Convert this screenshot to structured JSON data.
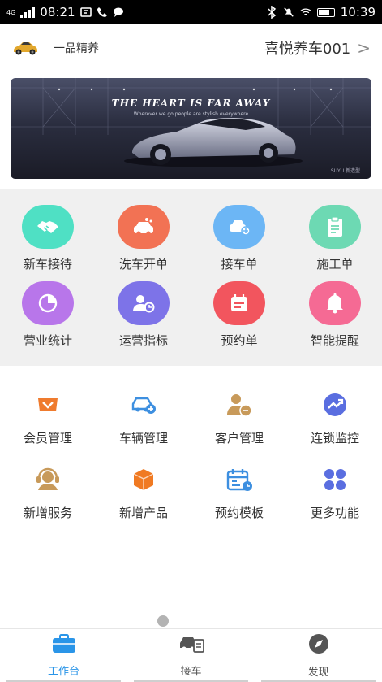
{
  "status_bar": {
    "network": "4G",
    "time_left": "08:21",
    "time_right": "10:39"
  },
  "header": {
    "shop_name": "一品精养",
    "store_name": "喜悦养车001",
    "chevron": ">"
  },
  "banner": {
    "title": "THE HEART IS FAR AWAY",
    "subtitle": "Wherever we go people are stylish everywhere",
    "brand": "SUYU 新造型"
  },
  "quick_actions": [
    {
      "label": "新车接待",
      "icon": "handshake-icon",
      "color": "#4fe0c4"
    },
    {
      "label": "洗车开单",
      "icon": "car-wash-icon",
      "color": "#f27254"
    },
    {
      "label": "接车单",
      "icon": "car-add-icon",
      "color": "#6cb6f5"
    },
    {
      "label": "施工单",
      "icon": "clipboard-icon",
      "color": "#6dd9b3"
    },
    {
      "label": "营业统计",
      "icon": "pie-chart-icon",
      "color": "#b876ea"
    },
    {
      "label": "运营指标",
      "icon": "user-stats-icon",
      "color": "#7d73e8"
    },
    {
      "label": "预约单",
      "icon": "calendar-icon",
      "color": "#f2555e"
    },
    {
      "label": "智能提醒",
      "icon": "bell-icon",
      "color": "#f56a94"
    }
  ],
  "functions": [
    {
      "label": "会员管理",
      "icon": "vip-diamond-icon",
      "color": "#ef7b2e"
    },
    {
      "label": "车辆管理",
      "icon": "car-manage-icon",
      "color": "#3d8fe0"
    },
    {
      "label": "客户管理",
      "icon": "customer-icon",
      "color": "#c89a5a"
    },
    {
      "label": "连锁监控",
      "icon": "trend-icon",
      "color": "#5a6ee0"
    },
    {
      "label": "新增服务",
      "icon": "headset-icon",
      "color": "#c89a5a"
    },
    {
      "label": "新增产品",
      "icon": "box-icon",
      "color": "#f07a22"
    },
    {
      "label": "预约模板",
      "icon": "calendar-template-icon",
      "color": "#3d8fe0"
    },
    {
      "label": "更多功能",
      "icon": "grid-more-icon",
      "color": "#5a6ee0"
    }
  ],
  "tabs": [
    {
      "label": "工作台",
      "icon": "briefcase-icon",
      "active": true
    },
    {
      "label": "接车",
      "icon": "car-receive-icon",
      "active": false
    },
    {
      "label": "发现",
      "icon": "compass-icon",
      "active": false
    }
  ]
}
